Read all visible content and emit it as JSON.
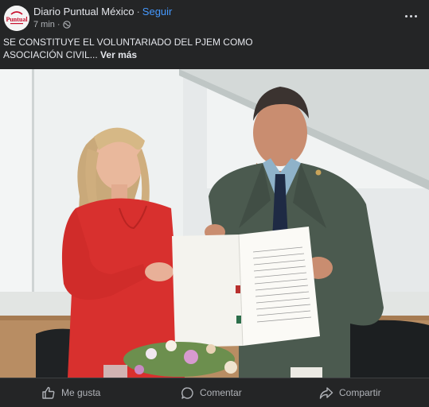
{
  "post": {
    "page_name": "Diario Puntual México",
    "separator": "·",
    "follow_label": "Seguir",
    "time": "7 min",
    "meta_separator": "·",
    "privacy_icon": "globe-icon",
    "more_icon": "more-options-icon",
    "avatar_logo_text": "Puntual",
    "caption_line1": "SE CONSTITUYE EL VOLUNTARIADO DEL PJEM COMO",
    "caption_line2": "ASOCIACIÓN CIVIL...",
    "see_more_label": "Ver más"
  },
  "actions": [
    {
      "label": "Me gusta",
      "icon": "thumbs-up-icon"
    },
    {
      "label": "Comentar",
      "icon": "comment-icon"
    },
    {
      "label": "Compartir",
      "icon": "share-icon"
    }
  ],
  "colors": {
    "background": "#242526",
    "link": "#4599ff",
    "text": "#e4e6eb",
    "muted": "#b0b3b8",
    "logo_red": "#c8102e"
  }
}
